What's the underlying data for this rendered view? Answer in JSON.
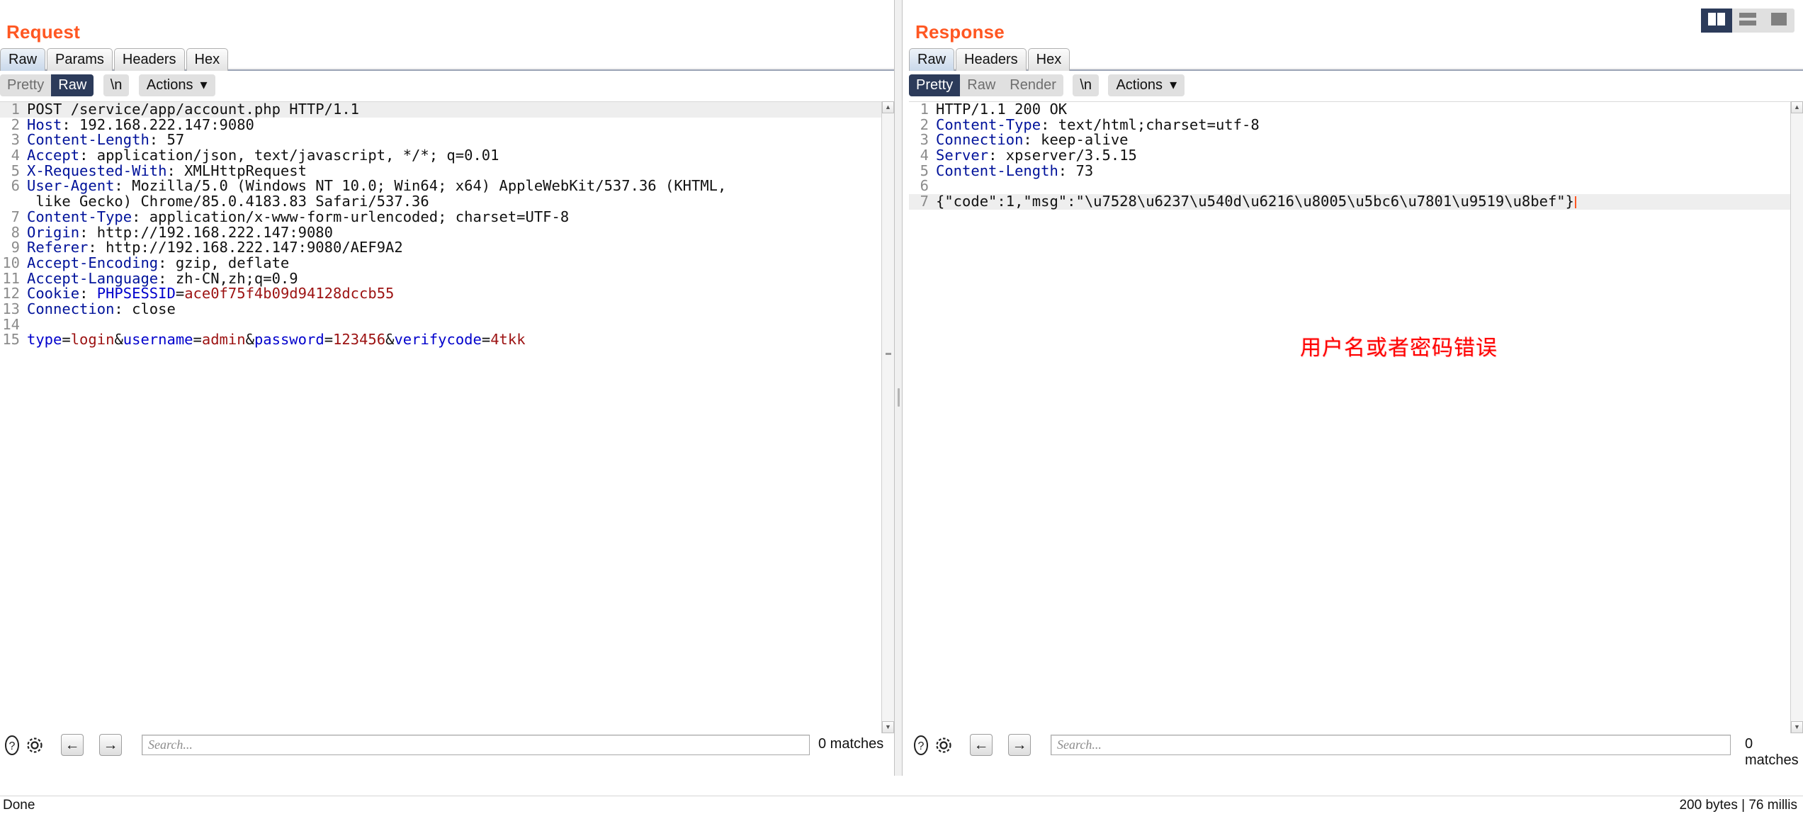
{
  "window": {
    "status_left": "Done",
    "status_right": "200 bytes | 76 millis"
  },
  "layout_buttons": [
    {
      "name": "side-by-side-layout",
      "active": true
    },
    {
      "name": "stacked-layout",
      "active": false
    },
    {
      "name": "single-pane-layout",
      "active": false
    }
  ],
  "request": {
    "title": "Request",
    "tabs": [
      {
        "label": "Raw",
        "active": true
      },
      {
        "label": "Params",
        "active": false
      },
      {
        "label": "Headers",
        "active": false
      },
      {
        "label": "Hex",
        "active": false
      }
    ],
    "view_modes": [
      {
        "label": "Pretty",
        "active": false
      },
      {
        "label": "Raw",
        "active": true
      }
    ],
    "newline_label": "\\n",
    "actions_label": "Actions",
    "find": {
      "placeholder": "Search...",
      "matches": "0 matches",
      "prev_label": "←",
      "next_label": "→"
    },
    "lines": [
      {
        "num": "1",
        "highlight": true,
        "parts": [
          {
            "t": "POST /service/app/account.php HTTP/1.1",
            "c": "val"
          }
        ]
      },
      {
        "num": "2",
        "highlight": false,
        "parts": [
          {
            "t": "Host",
            "c": "hdr"
          },
          {
            "t": ": 192.168.222.147:9080",
            "c": "val"
          }
        ]
      },
      {
        "num": "3",
        "highlight": false,
        "parts": [
          {
            "t": "Content-Length",
            "c": "hdr"
          },
          {
            "t": ": 57",
            "c": "val"
          }
        ]
      },
      {
        "num": "4",
        "highlight": false,
        "parts": [
          {
            "t": "Accept",
            "c": "hdr"
          },
          {
            "t": ": application/json, text/javascript, */*; q=0.01",
            "c": "val"
          }
        ]
      },
      {
        "num": "5",
        "highlight": false,
        "parts": [
          {
            "t": "X-Requested-With",
            "c": "hdr"
          },
          {
            "t": ": XMLHttpRequest",
            "c": "val"
          }
        ]
      },
      {
        "num": "6",
        "highlight": false,
        "parts": [
          {
            "t": "User-Agent",
            "c": "hdr"
          },
          {
            "t": ": Mozilla/5.0 (Windows NT 10.0; Win64; x64) AppleWebKit/537.36 (KHTML,",
            "c": "val"
          }
        ]
      },
      {
        "num": "",
        "highlight": false,
        "parts": [
          {
            "t": " like Gecko) Chrome/85.0.4183.83 Safari/537.36",
            "c": "val"
          }
        ]
      },
      {
        "num": "7",
        "highlight": false,
        "parts": [
          {
            "t": "Content-Type",
            "c": "hdr"
          },
          {
            "t": ": application/x-www-form-urlencoded; charset=UTF-8",
            "c": "val"
          }
        ]
      },
      {
        "num": "8",
        "highlight": false,
        "parts": [
          {
            "t": "Origin",
            "c": "hdr"
          },
          {
            "t": ": http://192.168.222.147:9080",
            "c": "val"
          }
        ]
      },
      {
        "num": "9",
        "highlight": false,
        "parts": [
          {
            "t": "Referer",
            "c": "hdr"
          },
          {
            "t": ": http://192.168.222.147:9080/AEF9A2",
            "c": "val"
          }
        ]
      },
      {
        "num": "10",
        "highlight": false,
        "parts": [
          {
            "t": "Accept-Encoding",
            "c": "hdr"
          },
          {
            "t": ": gzip, deflate",
            "c": "val"
          }
        ]
      },
      {
        "num": "11",
        "highlight": false,
        "parts": [
          {
            "t": "Accept-Language",
            "c": "hdr"
          },
          {
            "t": ": zh-CN,zh;q=0.9",
            "c": "val"
          }
        ]
      },
      {
        "num": "12",
        "highlight": false,
        "parts": [
          {
            "t": "Cookie",
            "c": "hdr"
          },
          {
            "t": ": ",
            "c": "val"
          },
          {
            "t": "PHPSESSID",
            "c": "blue"
          },
          {
            "t": "=",
            "c": "val"
          },
          {
            "t": "ace0f75f4b09d94128dccb55",
            "c": "red"
          }
        ]
      },
      {
        "num": "13",
        "highlight": false,
        "parts": [
          {
            "t": "Connection",
            "c": "hdr"
          },
          {
            "t": ": close",
            "c": "val"
          }
        ]
      },
      {
        "num": "14",
        "highlight": false,
        "parts": [
          {
            "t": "",
            "c": "val"
          }
        ]
      },
      {
        "num": "15",
        "highlight": false,
        "parts": [
          {
            "t": "type",
            "c": "blue"
          },
          {
            "t": "=",
            "c": "val"
          },
          {
            "t": "login",
            "c": "red"
          },
          {
            "t": "&",
            "c": "val"
          },
          {
            "t": "username",
            "c": "blue"
          },
          {
            "t": "=",
            "c": "val"
          },
          {
            "t": "admin",
            "c": "red"
          },
          {
            "t": "&",
            "c": "val"
          },
          {
            "t": "password",
            "c": "blue"
          },
          {
            "t": "=",
            "c": "val"
          },
          {
            "t": "123456",
            "c": "red"
          },
          {
            "t": "&",
            "c": "val"
          },
          {
            "t": "verifycode",
            "c": "blue"
          },
          {
            "t": "=",
            "c": "val"
          },
          {
            "t": "4tkk",
            "c": "red"
          }
        ]
      }
    ]
  },
  "response": {
    "title": "Response",
    "tabs": [
      {
        "label": "Raw",
        "active": true
      },
      {
        "label": "Headers",
        "active": false
      },
      {
        "label": "Hex",
        "active": false
      }
    ],
    "view_modes": [
      {
        "label": "Pretty",
        "active": true
      },
      {
        "label": "Raw",
        "active": false
      },
      {
        "label": "Render",
        "active": false
      }
    ],
    "newline_label": "\\n",
    "actions_label": "Actions",
    "find": {
      "placeholder": "Search...",
      "matches": "0 matches",
      "prev_label": "←",
      "next_label": "→"
    },
    "annotation": "用户名或者密码错误",
    "annotation_color": "#ff0000",
    "lines": [
      {
        "num": "1",
        "highlight": false,
        "parts": [
          {
            "t": "HTTP/1.1 200 OK",
            "c": "val"
          }
        ]
      },
      {
        "num": "2",
        "highlight": false,
        "parts": [
          {
            "t": "Content-Type",
            "c": "hdr"
          },
          {
            "t": ": text/html;charset=utf-8",
            "c": "val"
          }
        ]
      },
      {
        "num": "3",
        "highlight": false,
        "parts": [
          {
            "t": "Connection",
            "c": "hdr"
          },
          {
            "t": ": keep-alive",
            "c": "val"
          }
        ]
      },
      {
        "num": "4",
        "highlight": false,
        "parts": [
          {
            "t": "Server",
            "c": "hdr"
          },
          {
            "t": ": xpserver/3.5.15",
            "c": "val"
          }
        ]
      },
      {
        "num": "5",
        "highlight": false,
        "parts": [
          {
            "t": "Content-Length",
            "c": "hdr"
          },
          {
            "t": ": 73",
            "c": "val"
          }
        ]
      },
      {
        "num": "6",
        "highlight": false,
        "parts": [
          {
            "t": "",
            "c": "val"
          }
        ]
      },
      {
        "num": "7",
        "highlight": true,
        "caret": true,
        "parts": [
          {
            "t": "{\"code\":1,\"msg\":\"\\u7528\\u6237\\u540d\\u6216\\u8005\\u5bc6\\u7801\\u9519\\u8bef\"}",
            "c": "val"
          }
        ]
      }
    ]
  }
}
